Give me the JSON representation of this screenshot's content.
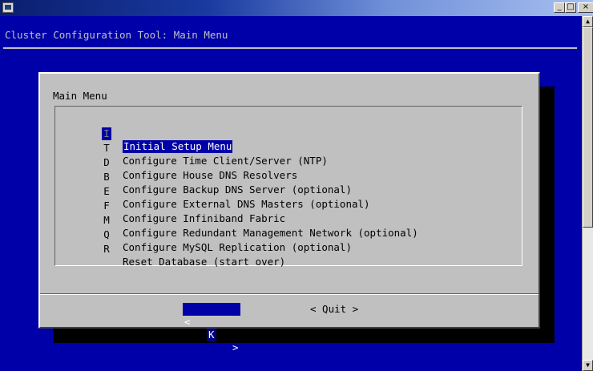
{
  "terminal": {
    "backtitle": "Cluster Configuration Tool: Main Menu"
  },
  "window_controls": {
    "minimize": "_",
    "maximize": "□",
    "close": "×"
  },
  "dialog": {
    "title": "Main Menu",
    "items": [
      {
        "tag": "I",
        "label": "Initial Setup Menu",
        "selected": true
      },
      {
        "tag": "T",
        "label": "Configure Time Client/Server (NTP)"
      },
      {
        "tag": "D",
        "label": "Configure House DNS Resolvers"
      },
      {
        "tag": "B",
        "label": "Configure Backup DNS Server (optional)"
      },
      {
        "tag": "E",
        "label": "Configure External DNS Masters (optional)"
      },
      {
        "tag": "F",
        "label": "Configure Infiniband Fabric"
      },
      {
        "tag": "M",
        "label": "Configure Redundant Management Network (optional)"
      },
      {
        "tag": "Q",
        "label": "Configure MySQL Replication (optional)"
      },
      {
        "tag": "R",
        "label": "Reset Database (start over)"
      }
    ],
    "ok_button": {
      "left": "<",
      "text": "K",
      "right": ">"
    },
    "quit_button": "< Quit >"
  },
  "colors": {
    "terminal_bg": "#0000a8",
    "dialog_bg": "#c0c0c0",
    "highlight": "#0000a8"
  }
}
